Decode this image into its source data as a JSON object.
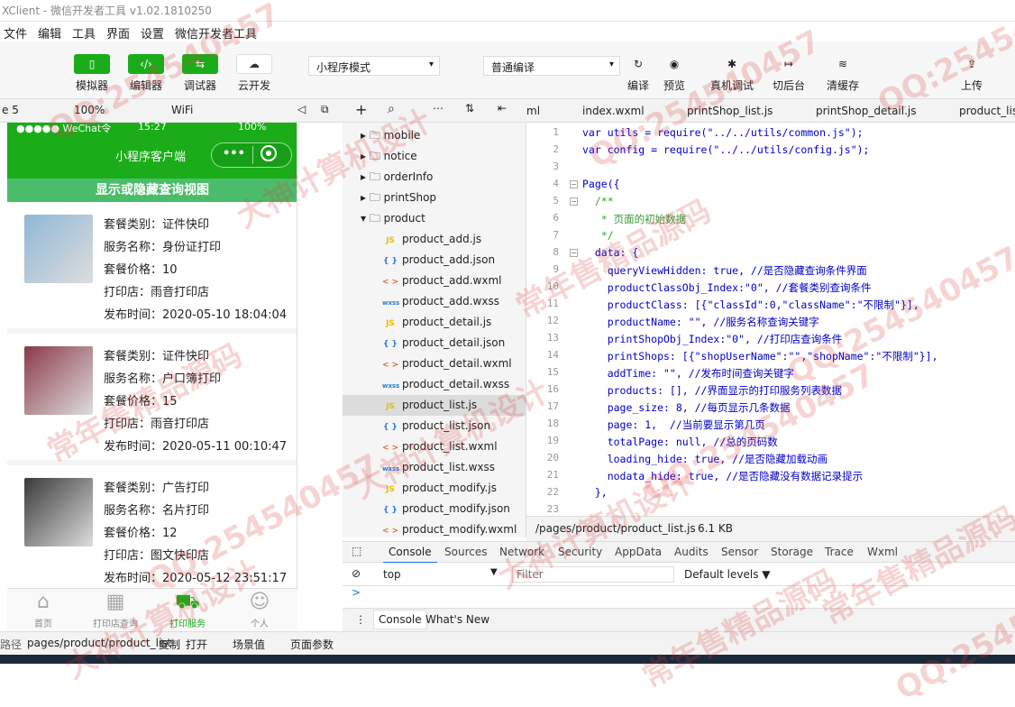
{
  "window": {
    "title": "XClient - 微信开发者工具 v1.02.1810250"
  },
  "menu": [
    "文件",
    "编辑",
    "工具",
    "界面",
    "设置",
    "微信开发者工具"
  ],
  "toolbar": {
    "simulator": "模拟器",
    "editor": "编辑器",
    "debugger": "调试器",
    "cloud": "云开发",
    "mode": "小程序模式",
    "compile_mode": "普通编译",
    "compile": "编译",
    "preview": "预览",
    "remote_debug": "真机调试",
    "background": "切后台",
    "clear_cache": "清缓存",
    "upload": "上传",
    "simulator_icon": "phone-icon",
    "editor_icon": "code-icon",
    "debugger_icon": "debug-icon",
    "cloud_icon": "cloud-icon"
  },
  "simbar": {
    "device": "e 5",
    "zoom": "100%",
    "network": "WiFi"
  },
  "phone": {
    "status_time": "15:27",
    "status_carrier": "●●●●● WeChat令",
    "status_battery": "100%",
    "title": "小程序客户端",
    "capsule": "•••",
    "search_toggle": "显示或隐藏查询视图",
    "labels": {
      "category": "套餐类别：",
      "service": "服务名称：",
      "price": "套餐价格：",
      "shop": "打印店：",
      "time": "发布时间："
    },
    "products": [
      {
        "category": "证件快印",
        "service": "身份证打印",
        "price": "10",
        "shop": "雨音打印店",
        "time": "2020-05-10 18:04:04",
        "img_color": "#8fb7d6"
      },
      {
        "category": "证件快印",
        "service": "户口簿打印",
        "price": "15",
        "shop": "雨音打印店",
        "time": "2020-05-11 00:10:47",
        "img_color": "#8b3a4a"
      },
      {
        "category": "广告打印",
        "service": "名片打印",
        "price": "12",
        "shop": "图文快印店",
        "time": "2020-05-12 23:51:17",
        "img_color": "#3a3a3a"
      }
    ],
    "tabs": [
      {
        "label": "首页",
        "icon": "home-icon"
      },
      {
        "label": "打印店查询",
        "icon": "grid-icon"
      },
      {
        "label": "打印服务",
        "icon": "cart-icon"
      },
      {
        "label": "个人",
        "icon": "user-icon"
      }
    ]
  },
  "simstatus": {
    "path_label": "路径",
    "path": "pages/product/product_list",
    "copy": "复制",
    "open": "打开",
    "scene": "场景值",
    "params": "页面参数"
  },
  "tree": {
    "folders": [
      "mobile",
      "notice",
      "orderInfo",
      "printShop",
      "product"
    ],
    "files": [
      {
        "type": "JS",
        "name": "product_add.js"
      },
      {
        "type": "{ }",
        "name": "product_add.json"
      },
      {
        "type": "< >",
        "name": "product_add.wxml"
      },
      {
        "type": "wxss",
        "name": "product_add.wxss"
      },
      {
        "type": "JS",
        "name": "product_detail.js"
      },
      {
        "type": "{ }",
        "name": "product_detail.json"
      },
      {
        "type": "< >",
        "name": "product_detail.wxml"
      },
      {
        "type": "wxss",
        "name": "product_detail.wxss"
      },
      {
        "type": "JS",
        "name": "product_list.js"
      },
      {
        "type": "{ }",
        "name": "product_list.json"
      },
      {
        "type": "< >",
        "name": "product_list.wxml"
      },
      {
        "type": "wxss",
        "name": "product_list.wxss"
      },
      {
        "type": "JS",
        "name": "product_modify.js"
      },
      {
        "type": "{ }",
        "name": "product_modify.json"
      },
      {
        "type": "< >",
        "name": "product_modify.wxml"
      }
    ]
  },
  "editor": {
    "tabs": [
      "ml",
      "index.wxml",
      "printShop_list.js",
      "printShop_detail.js",
      "product_lis"
    ],
    "lines": [
      "var utils = require(\"../../utils/common.js\");",
      "var config = require(\"../../utils/config.js\");",
      "",
      "Page({",
      "  /**",
      "   * 页面的初始数据",
      "   */",
      "  data: {",
      "    queryViewHidden: true, //是否隐藏查询条件界面",
      "    productClassObj_Index:\"0\", //套餐类别查询条件",
      "    productClass: [{\"classId\":0,\"className\":\"不限制\"}],",
      "    productName: \"\", //服务名称查询关键字",
      "    printShopObj_Index:\"0\", //打印店查询条件",
      "    printShops: [{\"shopUserName\":\"\",\"shopName\":\"不限制\"}],",
      "    addTime: \"\", //发布时间查询关键字",
      "    products: [], //界面显示的打印服务列表数据",
      "    page_size: 8, //每页显示几条数据",
      "    page: 1,  //当前要显示第几页",
      "    totalPage: null, //总的页码数",
      "    loading_hide: true, //是否隐藏加载动画",
      "    nodata_hide: true, //是否隐藏没有数据记录提示",
      "  },",
      ""
    ],
    "filepath": "/pages/product/product_list.js",
    "filesize": "6.1 KB"
  },
  "devtools": {
    "tabs": [
      "Console",
      "Sources",
      "Network",
      "Security",
      "AppData",
      "Audits",
      "Sensor",
      "Storage",
      "Trace",
      "Wxml"
    ],
    "context": "top",
    "filter_placeholder": "Filter",
    "levels": "Default levels ▼",
    "prompt": ">",
    "drawer_tabs": [
      "Console",
      "What's New"
    ]
  },
  "watermarks": [
    "QQ:254540457",
    "大神计算机设计",
    "常年售精品源码"
  ],
  "colors": {
    "wechat_green": "#1aad19",
    "search_green": "#4bbd6a"
  }
}
